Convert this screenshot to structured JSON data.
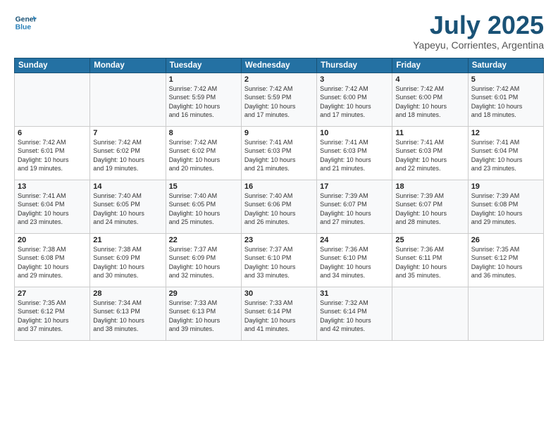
{
  "logo": {
    "line1": "General",
    "line2": "Blue"
  },
  "calendar": {
    "title": "July 2025",
    "subtitle": "Yapeyu, Corrientes, Argentina"
  },
  "weekdays": [
    "Sunday",
    "Monday",
    "Tuesday",
    "Wednesday",
    "Thursday",
    "Friday",
    "Saturday"
  ],
  "weeks": [
    [
      {
        "day": "",
        "detail": ""
      },
      {
        "day": "",
        "detail": ""
      },
      {
        "day": "1",
        "detail": "Sunrise: 7:42 AM\nSunset: 5:59 PM\nDaylight: 10 hours\nand 16 minutes."
      },
      {
        "day": "2",
        "detail": "Sunrise: 7:42 AM\nSunset: 5:59 PM\nDaylight: 10 hours\nand 17 minutes."
      },
      {
        "day": "3",
        "detail": "Sunrise: 7:42 AM\nSunset: 6:00 PM\nDaylight: 10 hours\nand 17 minutes."
      },
      {
        "day": "4",
        "detail": "Sunrise: 7:42 AM\nSunset: 6:00 PM\nDaylight: 10 hours\nand 18 minutes."
      },
      {
        "day": "5",
        "detail": "Sunrise: 7:42 AM\nSunset: 6:01 PM\nDaylight: 10 hours\nand 18 minutes."
      }
    ],
    [
      {
        "day": "6",
        "detail": "Sunrise: 7:42 AM\nSunset: 6:01 PM\nDaylight: 10 hours\nand 19 minutes."
      },
      {
        "day": "7",
        "detail": "Sunrise: 7:42 AM\nSunset: 6:02 PM\nDaylight: 10 hours\nand 19 minutes."
      },
      {
        "day": "8",
        "detail": "Sunrise: 7:42 AM\nSunset: 6:02 PM\nDaylight: 10 hours\nand 20 minutes."
      },
      {
        "day": "9",
        "detail": "Sunrise: 7:41 AM\nSunset: 6:03 PM\nDaylight: 10 hours\nand 21 minutes."
      },
      {
        "day": "10",
        "detail": "Sunrise: 7:41 AM\nSunset: 6:03 PM\nDaylight: 10 hours\nand 21 minutes."
      },
      {
        "day": "11",
        "detail": "Sunrise: 7:41 AM\nSunset: 6:03 PM\nDaylight: 10 hours\nand 22 minutes."
      },
      {
        "day": "12",
        "detail": "Sunrise: 7:41 AM\nSunset: 6:04 PM\nDaylight: 10 hours\nand 23 minutes."
      }
    ],
    [
      {
        "day": "13",
        "detail": "Sunrise: 7:41 AM\nSunset: 6:04 PM\nDaylight: 10 hours\nand 23 minutes."
      },
      {
        "day": "14",
        "detail": "Sunrise: 7:40 AM\nSunset: 6:05 PM\nDaylight: 10 hours\nand 24 minutes."
      },
      {
        "day": "15",
        "detail": "Sunrise: 7:40 AM\nSunset: 6:05 PM\nDaylight: 10 hours\nand 25 minutes."
      },
      {
        "day": "16",
        "detail": "Sunrise: 7:40 AM\nSunset: 6:06 PM\nDaylight: 10 hours\nand 26 minutes."
      },
      {
        "day": "17",
        "detail": "Sunrise: 7:39 AM\nSunset: 6:07 PM\nDaylight: 10 hours\nand 27 minutes."
      },
      {
        "day": "18",
        "detail": "Sunrise: 7:39 AM\nSunset: 6:07 PM\nDaylight: 10 hours\nand 28 minutes."
      },
      {
        "day": "19",
        "detail": "Sunrise: 7:39 AM\nSunset: 6:08 PM\nDaylight: 10 hours\nand 29 minutes."
      }
    ],
    [
      {
        "day": "20",
        "detail": "Sunrise: 7:38 AM\nSunset: 6:08 PM\nDaylight: 10 hours\nand 29 minutes."
      },
      {
        "day": "21",
        "detail": "Sunrise: 7:38 AM\nSunset: 6:09 PM\nDaylight: 10 hours\nand 30 minutes."
      },
      {
        "day": "22",
        "detail": "Sunrise: 7:37 AM\nSunset: 6:09 PM\nDaylight: 10 hours\nand 32 minutes."
      },
      {
        "day": "23",
        "detail": "Sunrise: 7:37 AM\nSunset: 6:10 PM\nDaylight: 10 hours\nand 33 minutes."
      },
      {
        "day": "24",
        "detail": "Sunrise: 7:36 AM\nSunset: 6:10 PM\nDaylight: 10 hours\nand 34 minutes."
      },
      {
        "day": "25",
        "detail": "Sunrise: 7:36 AM\nSunset: 6:11 PM\nDaylight: 10 hours\nand 35 minutes."
      },
      {
        "day": "26",
        "detail": "Sunrise: 7:35 AM\nSunset: 6:12 PM\nDaylight: 10 hours\nand 36 minutes."
      }
    ],
    [
      {
        "day": "27",
        "detail": "Sunrise: 7:35 AM\nSunset: 6:12 PM\nDaylight: 10 hours\nand 37 minutes."
      },
      {
        "day": "28",
        "detail": "Sunrise: 7:34 AM\nSunset: 6:13 PM\nDaylight: 10 hours\nand 38 minutes."
      },
      {
        "day": "29",
        "detail": "Sunrise: 7:33 AM\nSunset: 6:13 PM\nDaylight: 10 hours\nand 39 minutes."
      },
      {
        "day": "30",
        "detail": "Sunrise: 7:33 AM\nSunset: 6:14 PM\nDaylight: 10 hours\nand 41 minutes."
      },
      {
        "day": "31",
        "detail": "Sunrise: 7:32 AM\nSunset: 6:14 PM\nDaylight: 10 hours\nand 42 minutes."
      },
      {
        "day": "",
        "detail": ""
      },
      {
        "day": "",
        "detail": ""
      }
    ]
  ]
}
